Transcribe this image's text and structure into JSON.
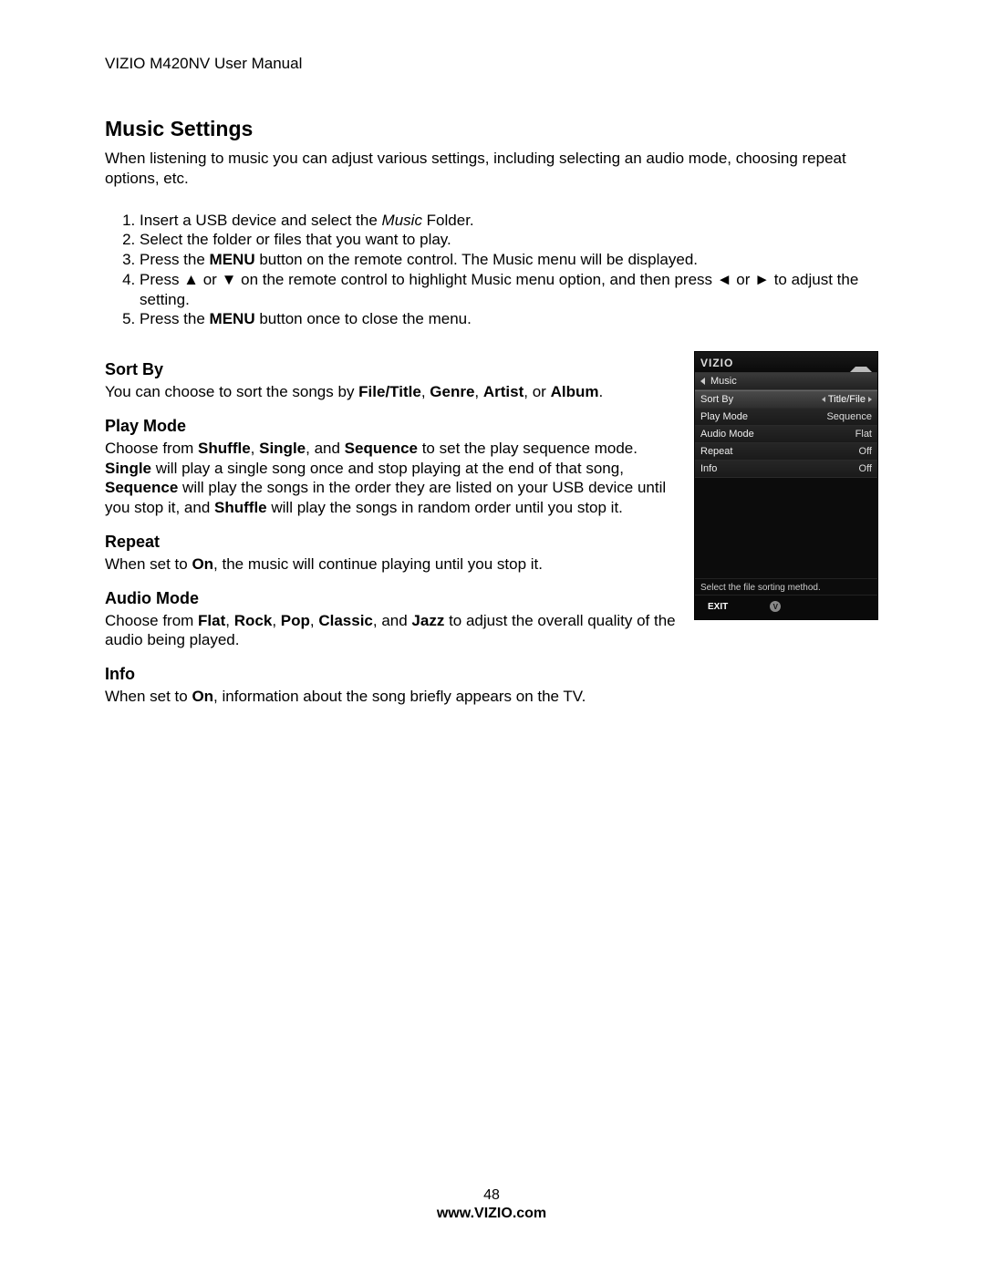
{
  "header": "VIZIO M420NV User Manual",
  "title": "Music Settings",
  "intro": "When listening to music you can adjust various settings, including selecting an audio mode, choosing repeat options, etc.",
  "steps": {
    "s1a": "Insert a USB device and select the ",
    "s1_italic": "Music",
    "s1b": " Folder.",
    "s2": "Select the folder or files that you want to play.",
    "s3a": "Press the ",
    "s3_bold": "MENU",
    "s3b": " button on the remote control. The Music menu will be displayed.",
    "s4a": "Press ▲ or ▼ on the remote control to highlight Music menu option, and then press ◄ or ► to adjust the setting.",
    "s5a": "Press the ",
    "s5_bold": "MENU",
    "s5b": " button once to close the menu."
  },
  "sections": {
    "sortby": {
      "h": "Sort By",
      "p_a": "You can choose to sort the songs by ",
      "b1": "File/Title",
      "c1": ", ",
      "b2": "Genre",
      "c2": ", ",
      "b3": "Artist",
      "c3": ", or ",
      "b4": "Album",
      "c4": "."
    },
    "playmode": {
      "h": "Play Mode",
      "a": "Choose from ",
      "b1": "Shuffle",
      "c1": ", ",
      "b2": "Single",
      "c2": ", and ",
      "b3": "Sequence",
      "d": " to set the play sequence mode. ",
      "b4": "Single",
      "e": " will play a single song once and stop playing at the end of that song, ",
      "b5": "Sequence",
      "f": " will play the songs in the order they are listed on your USB device until you stop it, and ",
      "b6": "Shuffle",
      "g": " will play the songs in random order until you stop it."
    },
    "repeat": {
      "h": "Repeat",
      "a": "When set to ",
      "b1": "On",
      "c": ", the music will continue playing until you stop it."
    },
    "audiomode": {
      "h": "Audio Mode",
      "a": "Choose from ",
      "b1": "Flat",
      "c1": ", ",
      "b2": "Rock",
      "c2": ", ",
      "b3": "Pop",
      "c3": ", ",
      "b4": "Classic",
      "c4": ", and ",
      "b5": "Jazz",
      "d": " to adjust the overall quality of the audio being played."
    },
    "info": {
      "h": "Info",
      "a": "When set to ",
      "b1": "On",
      "c": ", information about the song briefly appears on the TV."
    }
  },
  "osd": {
    "logo": "VIZIO",
    "crumb": "Music",
    "rows": [
      {
        "label": "Sort By",
        "value": "Title/File",
        "selected": true,
        "arrows": true
      },
      {
        "label": "Play Mode",
        "value": "Sequence"
      },
      {
        "label": "Audio Mode",
        "value": "Flat"
      },
      {
        "label": "Repeat",
        "value": "Off"
      },
      {
        "label": "Info",
        "value": "Off"
      }
    ],
    "hint": "Select the file sorting method.",
    "exit": "EXIT"
  },
  "footer": {
    "page": "48",
    "url": "www.VIZIO.com"
  }
}
